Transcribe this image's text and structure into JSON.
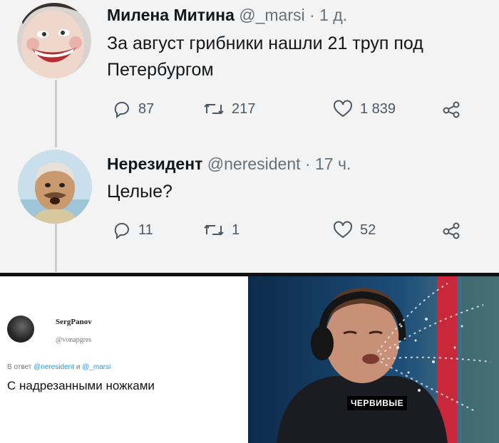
{
  "tweet1": {
    "name": "Милена Митина",
    "handle": "@_marsi",
    "time": "· 1 д.",
    "text_line1": "За август грибники нашли 21 труп под",
    "text_line2": "Петербургом",
    "replies": "87",
    "retweets": "217",
    "likes": "1 839"
  },
  "tweet2": {
    "name": "Нерезидент",
    "handle": "@neresident",
    "time": "· 17 ч.",
    "text": "Целые?",
    "replies": "11",
    "retweets": "1",
    "likes": "52"
  },
  "reply": {
    "name": "SergPanov",
    "handle": "@vonapgres",
    "to_prefix": "В ответ",
    "to_user1": "@neresident",
    "to_and": "и",
    "to_user2": "@_marsi",
    "text": "С надрезанными ножками"
  },
  "meme": {
    "caption": "ЧЕРВИВЫЕ"
  },
  "icons": [
    "reply-icon",
    "retweet-icon",
    "like-icon",
    "share-icon"
  ],
  "colors": {
    "panel_bg": "#f3f3f3",
    "meta": "#65717b",
    "link": "#1d9bf0"
  }
}
